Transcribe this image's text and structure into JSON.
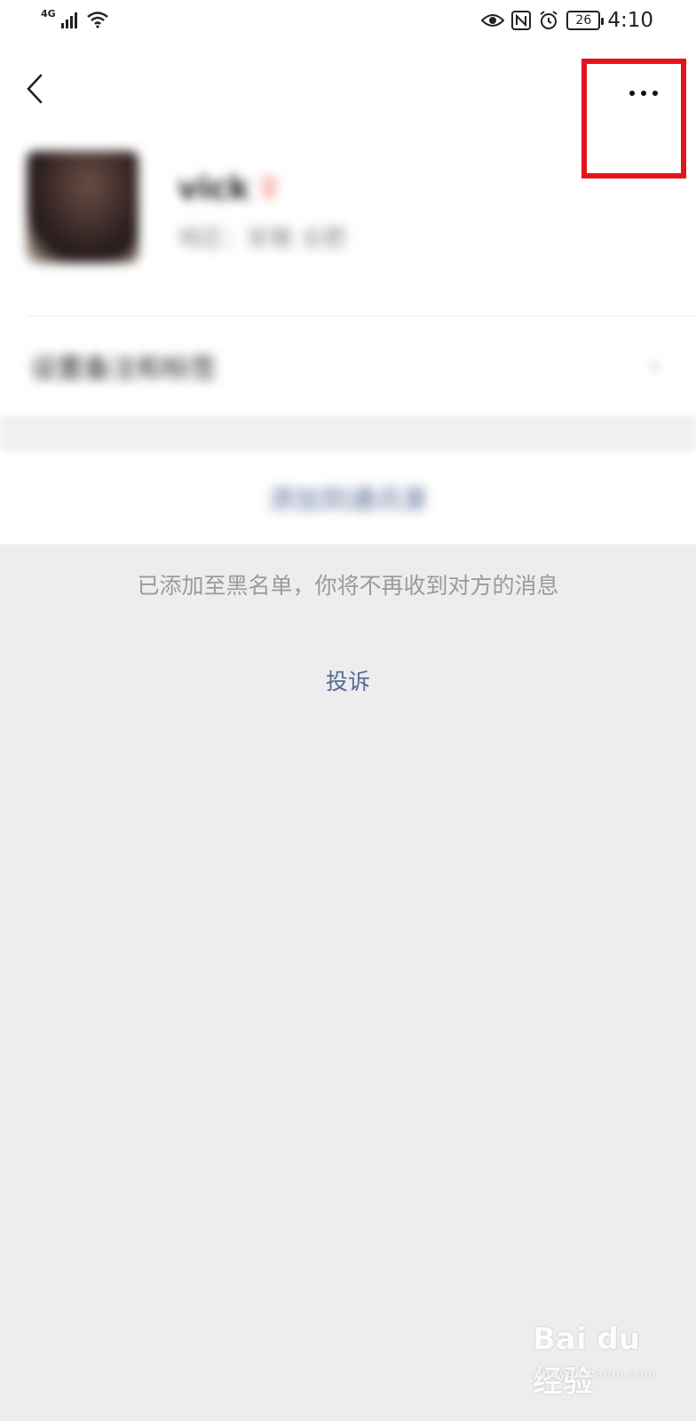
{
  "status_bar": {
    "network": "4G",
    "battery": "26",
    "time": "4:10"
  },
  "profile": {
    "name": "vick",
    "gender_mark": "♀",
    "region": "地区：安徽 合肥"
  },
  "rows": {
    "remark_label": "设置备注和标签",
    "chevron": "›",
    "action_label": "添加到通讯录"
  },
  "notice": "已添加至黑名单，你将不再收到对方的消息",
  "complain_label": "投诉",
  "watermark": {
    "main": "Bai du 经验",
    "sub": "jingyan.baidu.com"
  },
  "colors": {
    "link": "#576b95",
    "highlight": "#e5141b",
    "background": "#ededed"
  }
}
